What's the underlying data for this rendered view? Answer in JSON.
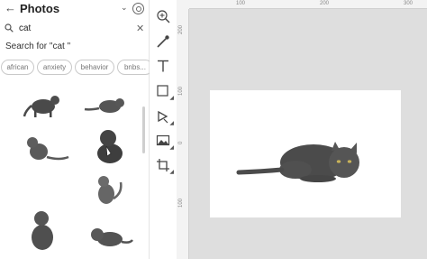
{
  "header": {
    "back_icon": "arrow-left-icon",
    "title": "Photos",
    "menu_icon": "chevron-down-icon",
    "settings_icon": "gear-icon"
  },
  "search": {
    "query": "cat",
    "clear_icon": "close-icon",
    "search_for": "Search for \"cat \""
  },
  "chips": [
    {
      "label": "african"
    },
    {
      "label": "anxiety"
    },
    {
      "label": "behavior"
    },
    {
      "label": "bnbs..."
    }
  ],
  "photos": [
    {
      "name": "cat-photo-1"
    },
    {
      "name": "cat-photo-2"
    },
    {
      "name": "cat-photo-3"
    },
    {
      "name": "cat-photo-4"
    },
    {
      "name": "cat-photo-5"
    },
    {
      "name": "cat-photo-6"
    },
    {
      "name": "cat-photo-7"
    }
  ],
  "tools": [
    {
      "name": "zoom-tool",
      "icon": "zoom-in-icon"
    },
    {
      "name": "eyedropper-tool",
      "icon": "eyedropper-icon"
    },
    {
      "name": "text-tool",
      "icon": "text-icon"
    },
    {
      "name": "shape-tool",
      "icon": "rectangle-icon"
    },
    {
      "name": "fill-tool",
      "icon": "fill-icon"
    },
    {
      "name": "image-tool",
      "icon": "image-icon"
    },
    {
      "name": "crop-tool",
      "icon": "crop-icon"
    }
  ],
  "ruler": {
    "top_labels": [
      "100",
      "200",
      "300"
    ],
    "left_labels": [
      "200",
      "100",
      "0",
      "100"
    ]
  }
}
